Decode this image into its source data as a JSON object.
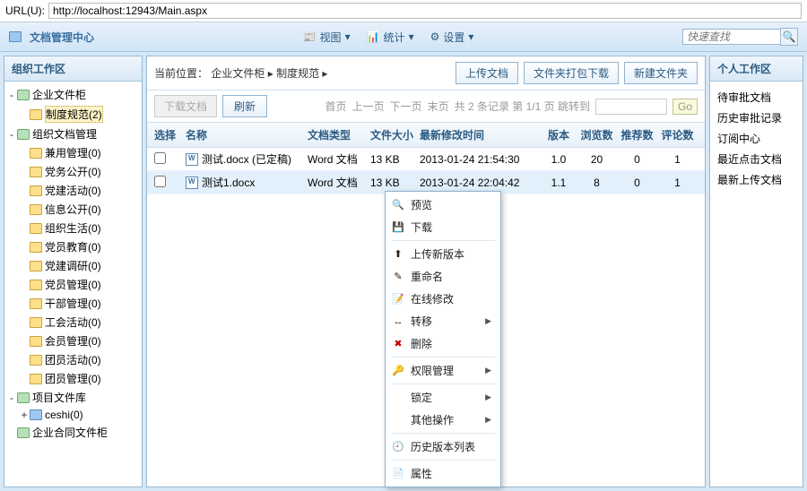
{
  "url": {
    "label": "URL(U):",
    "value": "http://localhost:12943/Main.aspx"
  },
  "app_title": "文档管理中心",
  "top_tools": [
    {
      "label": "视图",
      "icon": "window-icon"
    },
    {
      "label": "统计",
      "icon": "chart-icon"
    },
    {
      "label": "设置",
      "icon": "gear-icon"
    }
  ],
  "search_placeholder": "快速查找",
  "left_panel_title": "组织工作区",
  "tree": [
    {
      "label": "企业文件柜",
      "depth": 0,
      "exp": "-",
      "icon": "db",
      "sel": false
    },
    {
      "label": "制度规范(2)",
      "depth": 1,
      "exp": "",
      "icon": "fld",
      "sel": true
    },
    {
      "label": "组织文档管理",
      "depth": 0,
      "exp": "-",
      "icon": "db",
      "sel": false
    },
    {
      "label": "兼用管理(0)",
      "depth": 1,
      "exp": "",
      "icon": "fld",
      "sel": false
    },
    {
      "label": "党务公开(0)",
      "depth": 1,
      "exp": "",
      "icon": "fld",
      "sel": false
    },
    {
      "label": "党建活动(0)",
      "depth": 1,
      "exp": "",
      "icon": "fld",
      "sel": false
    },
    {
      "label": "信息公开(0)",
      "depth": 1,
      "exp": "",
      "icon": "fld",
      "sel": false
    },
    {
      "label": "组织生活(0)",
      "depth": 1,
      "exp": "",
      "icon": "fld",
      "sel": false
    },
    {
      "label": "党员教育(0)",
      "depth": 1,
      "exp": "",
      "icon": "fld",
      "sel": false
    },
    {
      "label": "党建调研(0)",
      "depth": 1,
      "exp": "",
      "icon": "fld",
      "sel": false
    },
    {
      "label": "党员管理(0)",
      "depth": 1,
      "exp": "",
      "icon": "fld",
      "sel": false
    },
    {
      "label": "干部管理(0)",
      "depth": 1,
      "exp": "",
      "icon": "fld",
      "sel": false
    },
    {
      "label": "工会活动(0)",
      "depth": 1,
      "exp": "",
      "icon": "fld",
      "sel": false
    },
    {
      "label": "会员管理(0)",
      "depth": 1,
      "exp": "",
      "icon": "fld",
      "sel": false
    },
    {
      "label": "团员活动(0)",
      "depth": 1,
      "exp": "",
      "icon": "fld",
      "sel": false
    },
    {
      "label": "团员管理(0)",
      "depth": 1,
      "exp": "",
      "icon": "fld",
      "sel": false
    },
    {
      "label": "项目文件库",
      "depth": 0,
      "exp": "-",
      "icon": "db",
      "sel": false
    },
    {
      "label": "ceshi(0)",
      "depth": 1,
      "exp": "+",
      "icon": "fld-b",
      "sel": false
    },
    {
      "label": "企业合同文件柜",
      "depth": 0,
      "exp": "",
      "icon": "db",
      "sel": false
    }
  ],
  "breadcrumb": {
    "label": "当前位置：",
    "path": [
      "企业文件柜",
      "制度规范"
    ]
  },
  "bc_buttons": {
    "upload": "上传文档",
    "dlzip": "文件夹打包下载",
    "newfolder": "新建文件夹"
  },
  "tb2": {
    "download": "下载文档",
    "refresh": "刷新",
    "first": "首页",
    "prev": "上一页",
    "next": "下一页",
    "last": "末页",
    "info": "共 2 条记录 第 1/1 页 跳转到",
    "go": "Go"
  },
  "columns": {
    "select": "选择",
    "name": "名称",
    "type": "文档类型",
    "size": "文件大小",
    "time": "最新修改时间",
    "version": "版本",
    "views": "浏览数",
    "recs": "推荐数",
    "comments": "评论数"
  },
  "rows": [
    {
      "name": "测试.docx (已定稿)",
      "type": "Word 文档",
      "size": "13 KB",
      "time": "2013-01-24 21:54:30",
      "version": "1.0",
      "views": "20",
      "recs": "0",
      "comments": "1",
      "selected": false
    },
    {
      "name": "测试1.docx",
      "type": "Word 文档",
      "size": "13 KB",
      "time": "2013-01-24 22:04:42",
      "version": "1.1",
      "views": "8",
      "recs": "0",
      "comments": "1",
      "selected": true
    }
  ],
  "context_menu": [
    {
      "label": "预览",
      "icon": "🔍",
      "sub": false
    },
    {
      "label": "下载",
      "icon": "💾",
      "sub": false
    },
    {
      "sep": true
    },
    {
      "label": "上传新版本",
      "icon": "⬆",
      "sub": false
    },
    {
      "label": "重命名",
      "icon": "✎",
      "sub": false
    },
    {
      "label": "在线修改",
      "icon": "📝",
      "sub": false
    },
    {
      "label": "转移",
      "icon": "↔",
      "sub": true
    },
    {
      "label": "删除",
      "icon": "✖",
      "sub": false,
      "red": true
    },
    {
      "sep": true
    },
    {
      "label": "权限管理",
      "icon": "🔑",
      "sub": true
    },
    {
      "sep": true
    },
    {
      "label": "锁定",
      "icon": "",
      "sub": true
    },
    {
      "label": "其他操作",
      "icon": "",
      "sub": true
    },
    {
      "sep": true
    },
    {
      "label": "历史版本列表",
      "icon": "🕘",
      "sub": false
    },
    {
      "sep": true
    },
    {
      "label": "属性",
      "icon": "📄",
      "sub": false
    }
  ],
  "right_panel_title": "个人工作区",
  "right_links": [
    "待审批文档",
    "历史审批记录",
    "订阅中心",
    "最近点击文档",
    "最新上传文档"
  ]
}
